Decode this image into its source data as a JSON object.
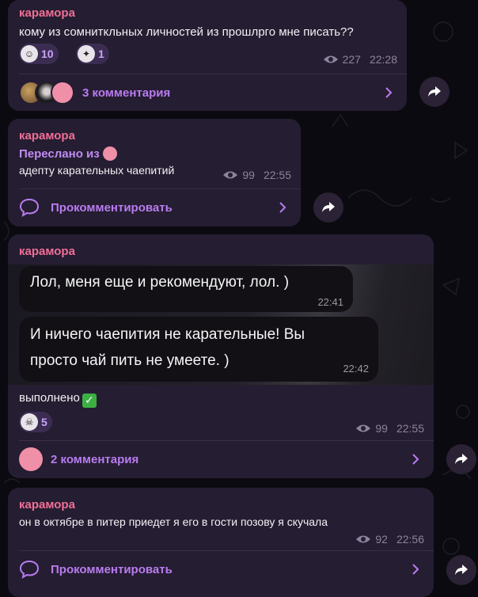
{
  "messages": [
    {
      "author": "карамора",
      "text": "кому из сомниткльных личностей из прошлрго мне писать??",
      "reactions": [
        {
          "icon": "face-sticker-icon",
          "count": "10"
        },
        {
          "icon": "cartoon-sticker-icon",
          "count": "1"
        }
      ],
      "views": "227",
      "time": "22:28",
      "comments_label": "3 комментария"
    },
    {
      "author": "карамора",
      "forwarded_label": "Переслано из",
      "text": "адепту карательных чаепитий",
      "views": "99",
      "time": "22:55",
      "comments_label": "Прокомментировать"
    },
    {
      "author": "карамора",
      "image_bubbles": [
        {
          "text": "Лол, меня еще и рекомендуют, лол. )",
          "time": "22:41"
        },
        {
          "text_line1": "И ничего чаепития не карательные! Вы",
          "text_line2": "просто чай пить не умеете. )",
          "time": "22:42"
        }
      ],
      "text": "выполнено",
      "reactions": [
        {
          "icon": "skull-sticker-icon",
          "count": "5"
        }
      ],
      "views": "99",
      "time": "22:55",
      "comments_label": "2 комментария"
    },
    {
      "author": "карамора",
      "text": "он в октябре в питер приедет я его в гости позову я скучала",
      "views": "92",
      "time": "22:56",
      "comments_label": "Прокомментировать"
    }
  ],
  "colors": {
    "background": "#0b0a10",
    "bubble": "#251d31",
    "author": "#f06f96",
    "accent": "#b87cf0",
    "meta": "#8e839c"
  }
}
